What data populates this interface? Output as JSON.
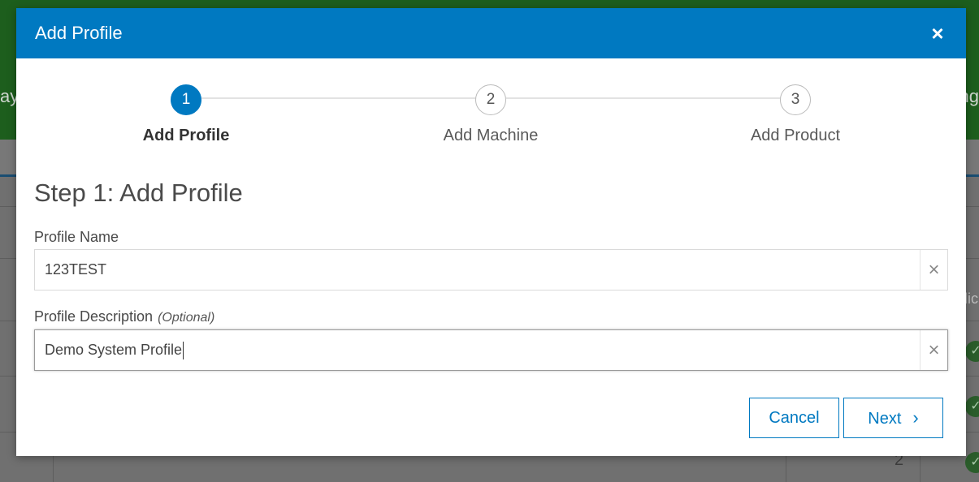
{
  "background": {
    "left_fragment": "ay",
    "right_fragment": "ng",
    "column_header_fragment": "lic",
    "row_count_value": "2",
    "check_icon": "check-circle-icon"
  },
  "modal": {
    "title": "Add Profile",
    "close_icon": "close-icon",
    "close_glyph": "×"
  },
  "stepper": {
    "steps": [
      {
        "number": "1",
        "label": "Add Profile",
        "active": true
      },
      {
        "number": "2",
        "label": "Add Machine",
        "active": false
      },
      {
        "number": "3",
        "label": "Add Product",
        "active": false
      }
    ]
  },
  "form": {
    "heading": "Step 1: Add Profile",
    "profile_name": {
      "label": "Profile Name",
      "value": "123TEST",
      "clear_glyph": "×"
    },
    "profile_description": {
      "label": "Profile Description",
      "optional_label": "(Optional)",
      "value": "Demo System Profile",
      "clear_glyph": "×"
    }
  },
  "buttons": {
    "cancel_label": "Cancel",
    "next_label": "Next",
    "next_icon": "chevron-right-icon",
    "next_glyph": "›"
  },
  "colors": {
    "accent": "#0079c1",
    "overlay": "#6f6f6f",
    "background_header": "#1d5e1d"
  }
}
